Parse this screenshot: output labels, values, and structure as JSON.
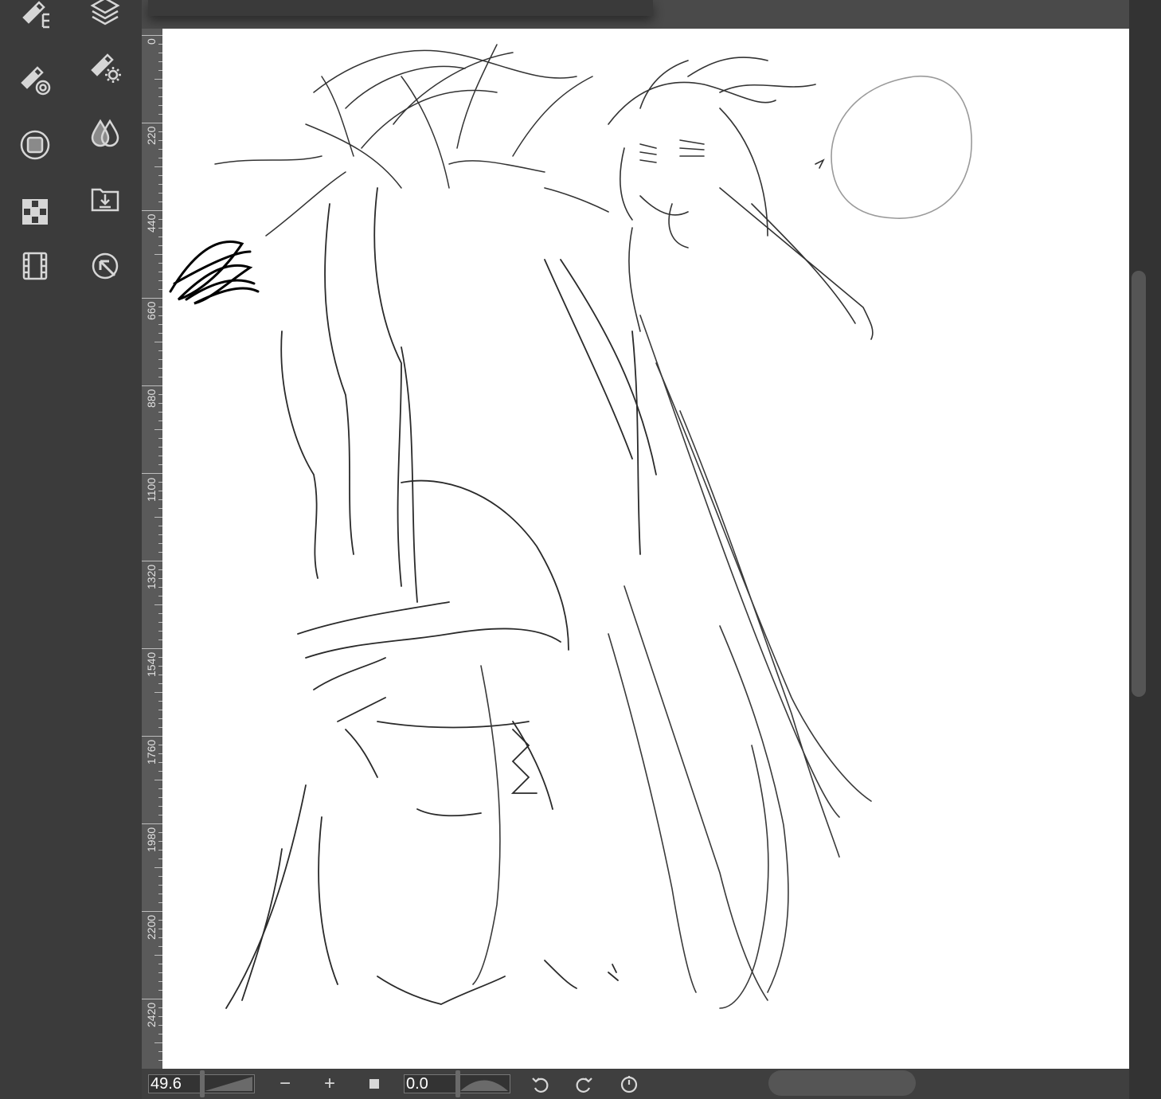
{
  "toolbar": {
    "tools_left": [
      "node-brush-icon",
      "brush-target-icon",
      "square-circle-icon",
      "checker-grid-icon",
      "film-strip-icon"
    ],
    "tools_right": [
      "layers-icon",
      "brush-settings-icon",
      "drops-icon",
      "import-download-icon",
      "cursor-target-icon"
    ]
  },
  "ruler": {
    "labels": [
      "0",
      "220",
      "440",
      "660",
      "880",
      "1100",
      "1320",
      "1540",
      "1760",
      "1980",
      "2200",
      "2420"
    ]
  },
  "bottom_bar": {
    "zoom_value": "49.6",
    "rotation_value": "0.0",
    "buttons": [
      "zoom-out",
      "zoom-in",
      "fit-square",
      "undo",
      "redo",
      "reset-rotation"
    ]
  },
  "colors": {
    "ui_dark": "#3b3b3b",
    "canvas": "#ffffff",
    "ruler": "#5a5a5a",
    "icon": "#d6d6d6"
  }
}
